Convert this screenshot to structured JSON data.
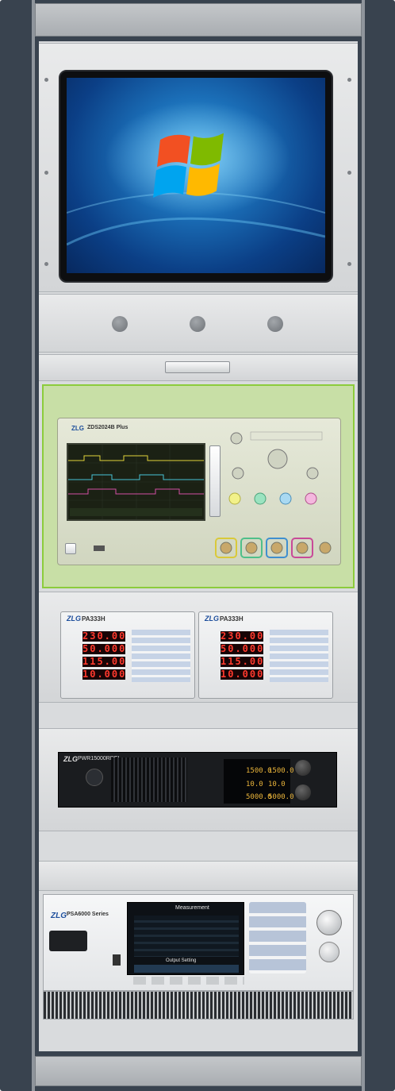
{
  "scope": {
    "brand": "ZLG",
    "model": "ZDS2024B Plus"
  },
  "power_analyzers": [
    {
      "brand": "ZLG",
      "model": "PA333H",
      "readings": [
        "230.00",
        "50.000",
        "115.00",
        "10.000"
      ]
    },
    {
      "brand": "ZLG",
      "model": "PA333H",
      "readings": [
        "230.00",
        "50.000",
        "115.00",
        "10.000"
      ]
    }
  ],
  "dc_load": {
    "brand": "ZLG",
    "model": "PWR15000RDEL",
    "readouts": [
      "1500.0",
      "1500.0",
      "10.0",
      "10.0",
      "5000.0",
      "5000.0"
    ]
  },
  "psa": {
    "brand": "ZLG",
    "model": "PSA6000 Series",
    "screen_title": "Measurement",
    "bottom_title": "Output Setting"
  },
  "colors": {
    "cabinet": "#39434f",
    "highlight": "#8ccc3c",
    "segment": "#ff3a2e"
  }
}
